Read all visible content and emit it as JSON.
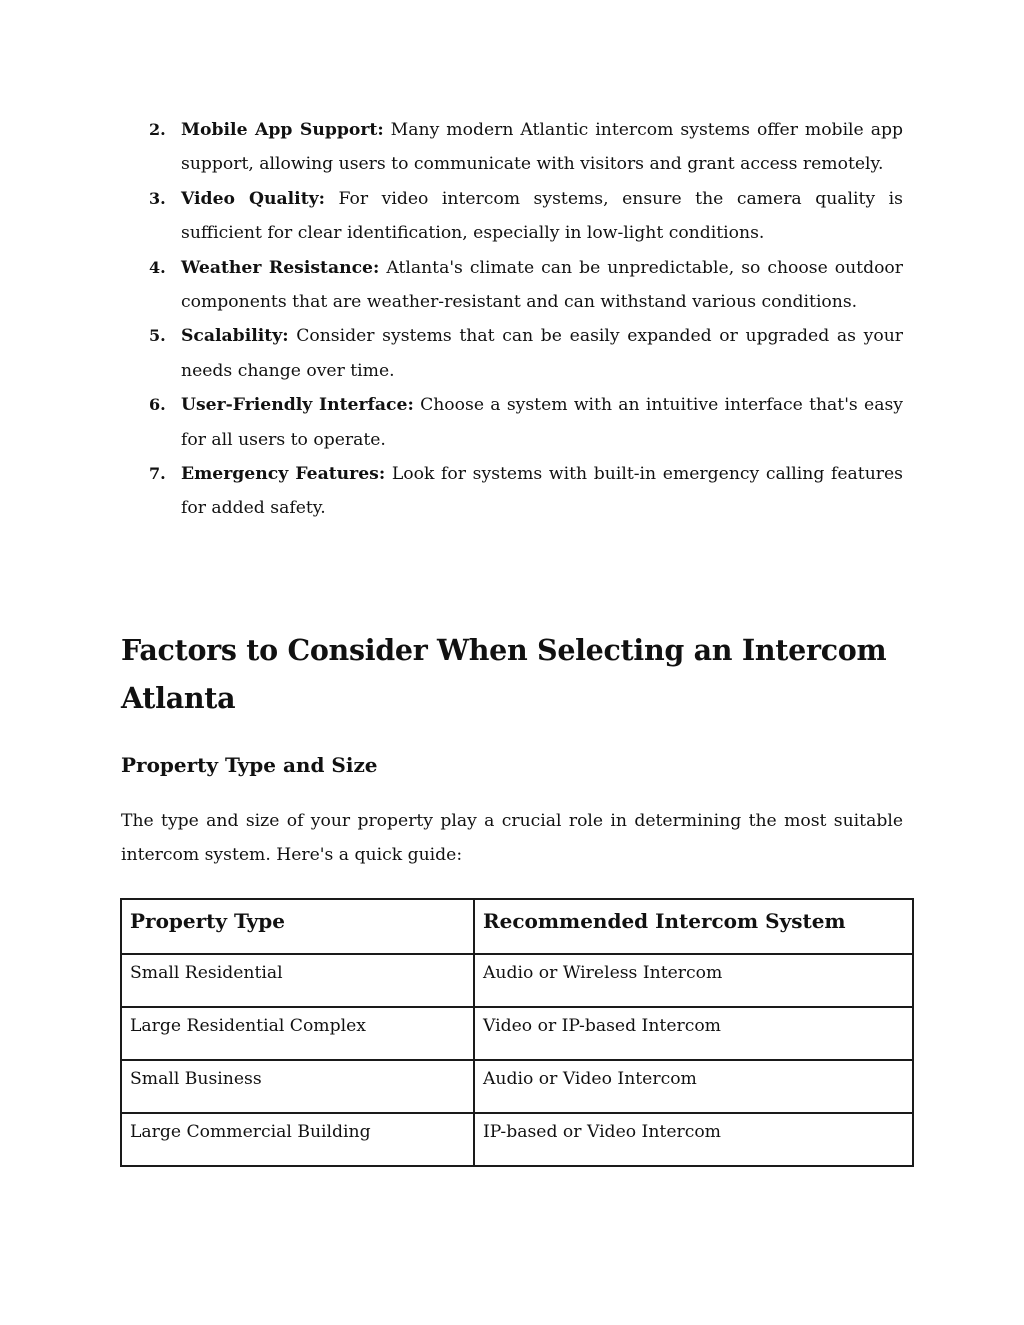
{
  "list": {
    "items": [
      {
        "number": "2.",
        "term": "Mobile App Support:",
        "text": " Many modern Atlantic intercom systems offer mobile app support, allowing users to communicate with visitors and grant access remotely."
      },
      {
        "number": "3.",
        "term": "Video Quality:",
        "text": " For video intercom systems, ensure the camera quality is sufficient for clear identification, especially in low-light conditions."
      },
      {
        "number": "4.",
        "term": "Weather Resistance:",
        "text": " Atlanta's climate can be unpredictable, so choose outdoor components that are weather-resistant and can withstand various conditions."
      },
      {
        "number": "5.",
        "term": "Scalability:",
        "text": " Consider systems that can be easily expanded or upgraded as your needs change over time."
      },
      {
        "number": "6.",
        "term": "User-Friendly Interface:",
        "text": " Choose a system with an intuitive interface that's easy for all users to operate."
      },
      {
        "number": "7.",
        "term": "Emergency Features:",
        "text": " Look for systems with built-in emergency calling features for added safety."
      }
    ]
  },
  "section": {
    "heading": "Factors to Consider When Selecting an Intercom Atlanta",
    "subheading": "Property Type and Size",
    "paragraph": "The type and size of your property play a crucial role in determining the most suitable intercom system. Here's a quick guide:"
  },
  "table": {
    "headers": [
      "Property Type",
      "Recommended Intercom System"
    ],
    "rows": [
      [
        "Small Residential",
        "Audio or Wireless Intercom"
      ],
      [
        "Large Residential Complex",
        "Video or IP-based Intercom"
      ],
      [
        "Small Business",
        "Audio or Video Intercom"
      ],
      [
        "Large Commercial Building",
        "IP-based or Video Intercom"
      ]
    ]
  }
}
